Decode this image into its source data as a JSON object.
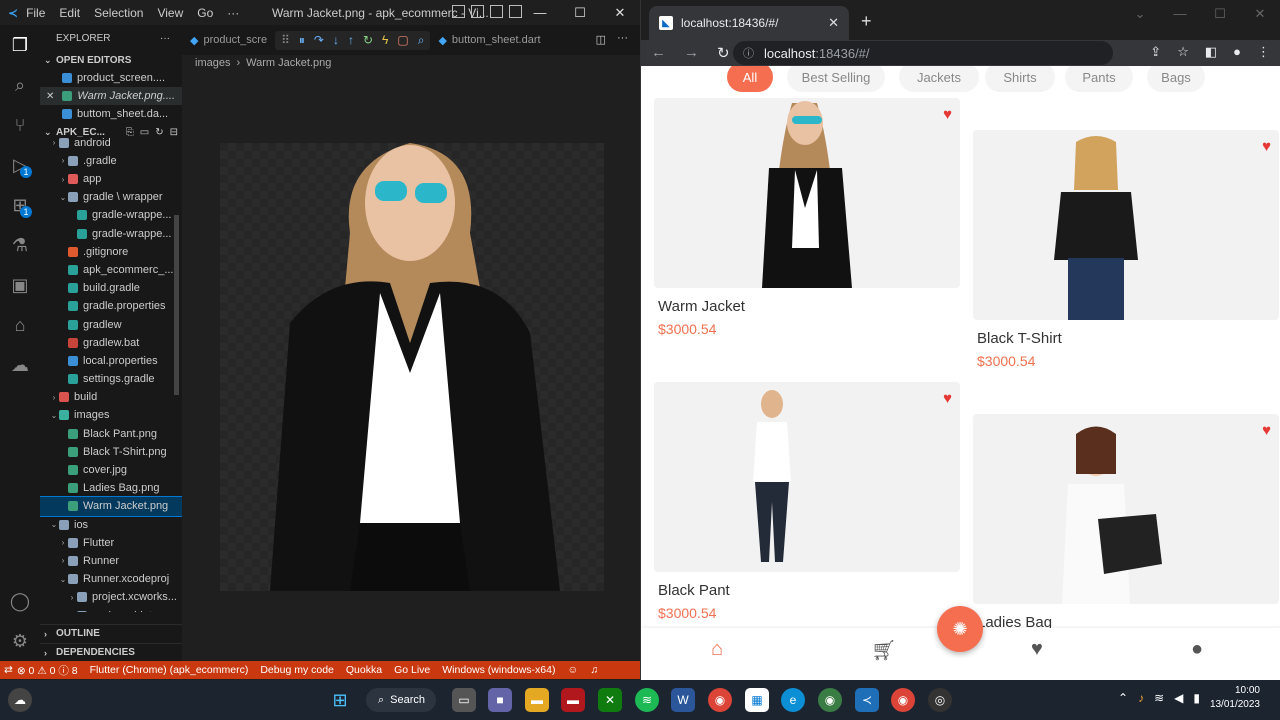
{
  "vscode": {
    "menu": [
      "File",
      "Edit",
      "Selection",
      "View",
      "Go",
      "···"
    ],
    "window_title": "Warm Jacket.png - apk_ecommerc - Vi...",
    "explorer_title": "EXPLORER",
    "open_editors_label": "OPEN EDITORS",
    "open_editors": [
      "product_screen....",
      "Warm Jacket.png....",
      "buttom_sheet.da..."
    ],
    "project_label": "APK_EC...",
    "tree": [
      {
        "label": "android",
        "depth": 1,
        "kind": "folder"
      },
      {
        "label": ".gradle",
        "depth": 2,
        "kind": "folder"
      },
      {
        "label": "app",
        "depth": 2,
        "kind": "folder"
      },
      {
        "label": "gradle \\ wrapper",
        "depth": 2,
        "kind": "folder-open"
      },
      {
        "label": "gradle-wrappe...",
        "depth": 3,
        "kind": "file"
      },
      {
        "label": "gradle-wrappe...",
        "depth": 3,
        "kind": "file"
      },
      {
        "label": ".gitignore",
        "depth": 2,
        "kind": "file"
      },
      {
        "label": "apk_ecommerc_...",
        "depth": 2,
        "kind": "file"
      },
      {
        "label": "build.gradle",
        "depth": 2,
        "kind": "file"
      },
      {
        "label": "gradle.properties",
        "depth": 2,
        "kind": "file"
      },
      {
        "label": "gradlew",
        "depth": 2,
        "kind": "file"
      },
      {
        "label": "gradlew.bat",
        "depth": 2,
        "kind": "file"
      },
      {
        "label": "local.properties",
        "depth": 2,
        "kind": "file"
      },
      {
        "label": "settings.gradle",
        "depth": 2,
        "kind": "file"
      },
      {
        "label": "build",
        "depth": 1,
        "kind": "folder"
      },
      {
        "label": "images",
        "depth": 1,
        "kind": "folder-open"
      },
      {
        "label": "Black Pant.png",
        "depth": 2,
        "kind": "file"
      },
      {
        "label": "Black T-Shirt.png",
        "depth": 2,
        "kind": "file"
      },
      {
        "label": "cover.jpg",
        "depth": 2,
        "kind": "file"
      },
      {
        "label": "Ladies Bag.png",
        "depth": 2,
        "kind": "file"
      },
      {
        "label": "Warm Jacket.png",
        "depth": 2,
        "kind": "file",
        "selected": true
      },
      {
        "label": "ios",
        "depth": 1,
        "kind": "folder-open"
      },
      {
        "label": "Flutter",
        "depth": 2,
        "kind": "folder"
      },
      {
        "label": "Runner",
        "depth": 2,
        "kind": "folder"
      },
      {
        "label": "Runner.xcodeproj",
        "depth": 2,
        "kind": "folder-open"
      },
      {
        "label": "project.xcworks...",
        "depth": 3,
        "kind": "folder"
      },
      {
        "label": "xcshareddata",
        "depth": 3,
        "kind": "folder"
      }
    ],
    "outline_label": "OUTLINE",
    "dependencies_label": "DEPENDENCIES",
    "tabs": {
      "left": "product_scre",
      "right": "buttom_sheet.dart"
    },
    "breadcrumb": [
      "images",
      "Warm Jacket.png"
    ],
    "status": [
      "⊗ 0 ⚠ 0 ⓘ 8",
      "Flutter (Chrome) (apk_ecommerc)",
      "Debug my code",
      "Quokka",
      "Go Live",
      "Windows (windows-x64)"
    ]
  },
  "browser": {
    "tab_title": "localhost:18436/#/",
    "url": "localhost",
    "url_port": ":18436/#/"
  },
  "app": {
    "categories": [
      {
        "label": "All",
        "active": true
      },
      {
        "label": "Best Selling",
        "active": false
      },
      {
        "label": "Jackets",
        "active": false
      },
      {
        "label": "Shirts",
        "active": false
      },
      {
        "label": "Pants",
        "active": false
      },
      {
        "label": "Bags",
        "active": false
      }
    ],
    "products": [
      {
        "name": "Warm Jacket",
        "price": "$3000.54",
        "favorite": true
      },
      {
        "name": "Black T-Shirt",
        "price": "$3000.54",
        "favorite": true
      },
      {
        "name": "Black Pant",
        "price": "$3000.54",
        "favorite": true
      },
      {
        "name": "Ladies Bag",
        "price": "",
        "favorite": true
      }
    ],
    "nav": [
      "home-icon",
      "cart-icon",
      "heart-icon",
      "person-icon"
    ],
    "accent": "#f46e4f"
  },
  "taskbar": {
    "search_label": "Search",
    "time": "10:00",
    "date": "13/01/2023"
  }
}
